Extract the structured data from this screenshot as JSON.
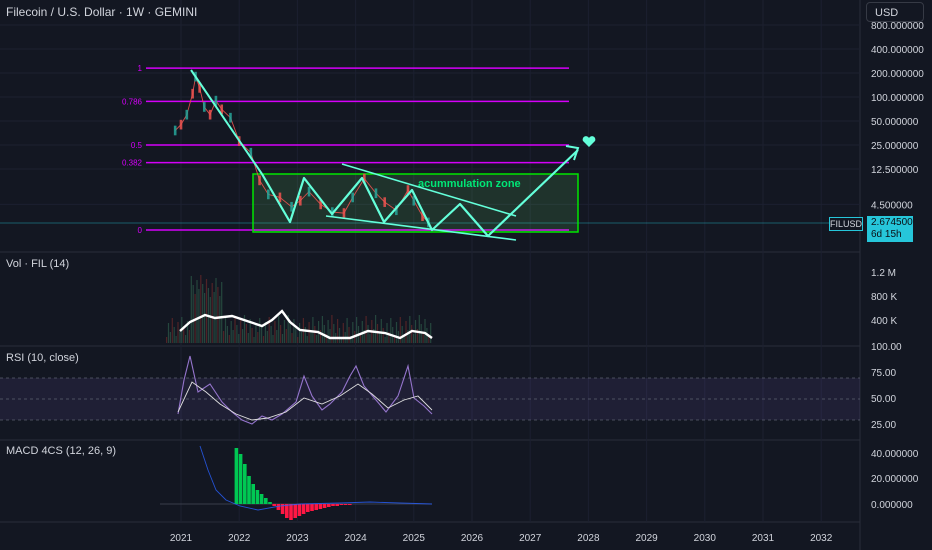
{
  "header": {
    "title": "Filecoin / U.S. Dollar · 1W · GEMINI",
    "currency_button": "USD"
  },
  "price_tag": {
    "symbol": "FILUSD",
    "price": "2.674500",
    "countdown": "6d 15h"
  },
  "colors": {
    "background": "#131722",
    "fib_line": "#d500f9",
    "drawing": "#64ffda",
    "zone_border": "#00e600",
    "zone_text": "#00e676",
    "price_line": "#26c6da",
    "rsi_line": "#9575cd",
    "volume_line": "#ffffff",
    "macd_up": "#00c853",
    "macd_down": "#ff1744"
  },
  "chart_data": [
    {
      "type": "line",
      "pane": "price",
      "scale": "log",
      "y_axis_ticks": [
        "800.000000",
        "400.000000",
        "200.000000",
        "100.000000",
        "50.000000",
        "25.000000",
        "12.500000",
        "4.500000"
      ],
      "x_axis_ticks": [
        "2021",
        "2022",
        "2023",
        "2024",
        "2025",
        "2026",
        "2027",
        "2028",
        "2029",
        "2030",
        "2031",
        "2032"
      ],
      "fib_levels": [
        {
          "label": "1",
          "value": 230
        },
        {
          "label": "0.786",
          "value": 88
        },
        {
          "label": "0.5",
          "value": 25
        },
        {
          "label": "0.382",
          "value": 15
        },
        {
          "label": "0",
          "value": 2.4
        }
      ],
      "series": [
        {
          "values": [
            {
              "x": 2020.9,
              "y": 38
            },
            {
              "x": 2021.0,
              "y": 45
            },
            {
              "x": 2021.1,
              "y": 60
            },
            {
              "x": 2021.2,
              "y": 110
            },
            {
              "x": 2021.25,
              "y": 180
            },
            {
              "x": 2021.32,
              "y": 130
            },
            {
              "x": 2021.4,
              "y": 75
            },
            {
              "x": 2021.5,
              "y": 60
            },
            {
              "x": 2021.6,
              "y": 90
            },
            {
              "x": 2021.7,
              "y": 70
            },
            {
              "x": 2021.85,
              "y": 55
            },
            {
              "x": 2022.0,
              "y": 28
            },
            {
              "x": 2022.2,
              "y": 20
            },
            {
              "x": 2022.35,
              "y": 9
            },
            {
              "x": 2022.5,
              "y": 6
            },
            {
              "x": 2022.7,
              "y": 5.5
            },
            {
              "x": 2022.9,
              "y": 4.2
            },
            {
              "x": 2023.05,
              "y": 5.0
            },
            {
              "x": 2023.2,
              "y": 6.5
            },
            {
              "x": 2023.4,
              "y": 4.5
            },
            {
              "x": 2023.6,
              "y": 3.6
            },
            {
              "x": 2023.8,
              "y": 3.5
            },
            {
              "x": 2023.95,
              "y": 5.5
            },
            {
              "x": 2024.15,
              "y": 9.5
            },
            {
              "x": 2024.35,
              "y": 6.2
            },
            {
              "x": 2024.5,
              "y": 4.8
            },
            {
              "x": 2024.7,
              "y": 3.8
            },
            {
              "x": 2024.9,
              "y": 6.8
            },
            {
              "x": 2025.0,
              "y": 5.0
            },
            {
              "x": 2025.15,
              "y": 3.2
            },
            {
              "x": 2025.25,
              "y": 2.67
            }
          ]
        }
      ],
      "annotations": [
        "acummulation zone"
      ]
    },
    {
      "type": "line",
      "pane": "volume",
      "title": "Vol · FIL (14)",
      "y_axis_ticks": [
        "1.2 M",
        "800 K",
        "400 K"
      ]
    },
    {
      "type": "line",
      "pane": "rsi",
      "title": "RSI (10, close)",
      "y_axis_ticks": [
        "100.00",
        "75.00",
        "50.00",
        "25.00"
      ],
      "bands": [
        30,
        70
      ]
    },
    {
      "type": "bar",
      "pane": "macd",
      "title": "MACD 4CS (12, 26, 9)",
      "y_axis_ticks": [
        "40.000000",
        "20.000000",
        "0.000000"
      ]
    }
  ]
}
